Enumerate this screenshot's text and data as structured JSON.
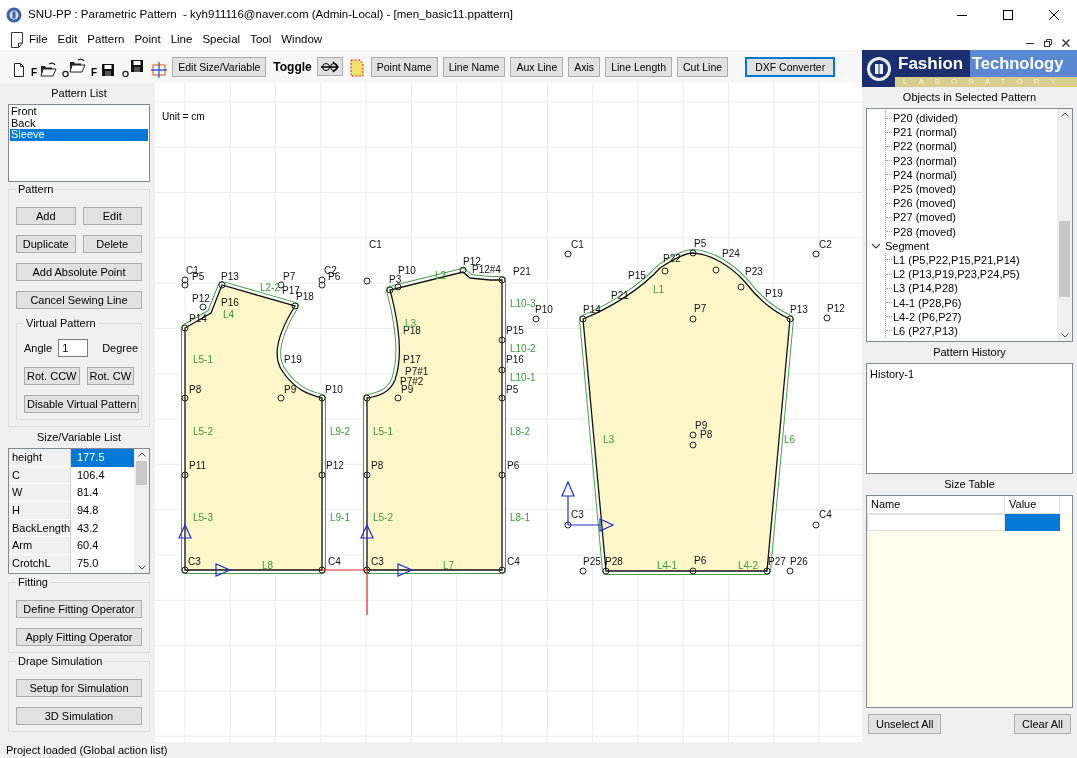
{
  "window": {
    "title": "SNU-PP : Parametric Pattern  - kyh911116@naver.com (Admin-Local) - [men_basic11.ppattern]"
  },
  "menu": [
    "File",
    "Edit",
    "Pattern",
    "Point",
    "Line",
    "Special",
    "Tool",
    "Window"
  ],
  "toolbar": [
    {
      "kind": "new"
    },
    {
      "kind": "open",
      "letter": "F"
    },
    {
      "kind": "open-circle"
    },
    {
      "kind": "save",
      "letter": "F"
    },
    {
      "kind": "save-circle"
    },
    {
      "kind": "grid"
    },
    {
      "kind": "button",
      "label": "Edit Size/Variable",
      "focused": false
    },
    {
      "kind": "text",
      "label": "Toggle"
    },
    {
      "kind": "toggle"
    },
    {
      "kind": "outline"
    },
    {
      "kind": "button",
      "label": "Point Name",
      "focused": false
    },
    {
      "kind": "button",
      "label": "Line Name",
      "focused": false
    },
    {
      "kind": "button",
      "label": "Aux Line",
      "focused": false
    },
    {
      "kind": "button",
      "label": "Axis",
      "focused": false
    },
    {
      "kind": "button",
      "label": "Line Length",
      "focused": false
    },
    {
      "kind": "button",
      "label": "Cut Line",
      "focused": false
    },
    {
      "kind": "button",
      "label": "DXF Converter",
      "focused": true
    }
  ],
  "pattern_list": {
    "title": "Pattern List",
    "items": [
      {
        "label": "Front",
        "selected": false
      },
      {
        "label": "Back",
        "selected": false
      },
      {
        "label": "Sleeve",
        "selected": true
      }
    ]
  },
  "pattern_group": {
    "title": "Pattern",
    "buttons": [
      "Add",
      "Edit",
      "Duplicate",
      "Delete",
      "Add Absolute Point",
      "Cancel Sewing Line"
    ],
    "virtual_pattern": {
      "title": "Virtual Pattern",
      "angle_label": "Angle",
      "angle_value": "1",
      "unit": "Degree",
      "buttons": [
        "Rot. CCW",
        "Rot. CW",
        "Disable Virtual Pattern"
      ]
    }
  },
  "size_list": {
    "title": "Size/Variable List",
    "rows": [
      {
        "name": "height",
        "value": "177.5",
        "selected": true
      },
      {
        "name": "C",
        "value": "106.4",
        "selected": false
      },
      {
        "name": "W",
        "value": "81.4",
        "selected": false
      },
      {
        "name": "H",
        "value": "94.8",
        "selected": false
      },
      {
        "name": "BackLength",
        "value": "43.2",
        "selected": false
      },
      {
        "name": "Arm",
        "value": "60.4",
        "selected": false
      },
      {
        "name": "CrotchL",
        "value": "75.0",
        "selected": false
      }
    ]
  },
  "fitting": {
    "title": "Fitting",
    "buttons": [
      "Define Fitting Operator",
      "Apply Fitting Operator"
    ]
  },
  "drape": {
    "title": "Drape Simulation",
    "buttons": [
      "Setup for Simulation",
      "3D Simulation"
    ]
  },
  "canvas": {
    "unit_label": "Unit = cm",
    "pieces": [
      {
        "kind": "front",
        "point_labels": [
          "C1",
          "P5",
          "P13",
          "P7",
          "C2",
          "P6",
          "P17",
          "P18",
          "P12",
          "P16",
          "P14",
          "P19",
          "P8",
          "P9",
          "P10",
          "P11",
          "P12",
          "C3",
          "C4"
        ],
        "line_labels": [
          "L2-2",
          "L4",
          "L5-1",
          "L5-2",
          "L9-2",
          "L5-3",
          "L9-1",
          "L8"
        ]
      },
      {
        "kind": "back",
        "point_labels": [
          "C1",
          "P10",
          "P3",
          "P12",
          "P12#4",
          "P21",
          "P10",
          "P18",
          "P15",
          "P16",
          "P17",
          "P7#1",
          "P7#2",
          "P5",
          "P9",
          "P8",
          "P6",
          "C3",
          "C4"
        ],
        "line_labels": [
          "L2",
          "L10-3",
          "L3",
          "L10-2",
          "L10-1",
          "L5-1",
          "L8-2",
          "L5-2",
          "L8-1",
          "L7"
        ]
      },
      {
        "kind": "sleeve",
        "point_labels": [
          "C1",
          "P5",
          "C2",
          "P22",
          "P24",
          "P23",
          "P15",
          "P21",
          "P19",
          "P14",
          "P7",
          "P13",
          "P12",
          "P9",
          "P8",
          "C3",
          "C4",
          "P25",
          "P28",
          "P6",
          "P27",
          "P26"
        ],
        "line_labels": [
          "L1",
          "L3",
          "L6",
          "L4-1",
          "L4-2"
        ]
      }
    ]
  },
  "logo": {
    "word_1": "Fashion",
    "word_2": "Technology",
    "subtitle": "LABORATORY"
  },
  "objects": {
    "title": "Objects in Selected Pattern",
    "tree": [
      {
        "children": [
          {
            "label": "P20 (divided)"
          },
          {
            "label": "P21 (normal)"
          },
          {
            "label": "P22 (normal)"
          },
          {
            "label": "P23 (normal)"
          },
          {
            "label": "P24 (normal)"
          },
          {
            "label": "P25 (moved)"
          },
          {
            "label": "P26 (moved)"
          },
          {
            "label": "P27 (moved)"
          },
          {
            "label": "P28 (moved)"
          }
        ]
      },
      {
        "label": "Segment",
        "expanded": true,
        "children": [
          {
            "label": "L1 (P5,P22,P15,P21,P14)"
          },
          {
            "label": "L2 (P13,P19,P23,P24,P5)"
          },
          {
            "label": "L3 (P14,P28)"
          },
          {
            "label": "L4-1 (P28,P6)"
          },
          {
            "label": "L4-2 (P6,P27)"
          },
          {
            "label": "L6 (P27,P13)"
          }
        ]
      }
    ]
  },
  "history": {
    "title": "Pattern History",
    "items": [
      "History-1"
    ]
  },
  "size_table": {
    "title": "Size Table",
    "columns": [
      "Name",
      "Value"
    ],
    "rows": [
      {
        "selected": true
      }
    ]
  },
  "panel_buttons": [
    "Unselect All",
    "Clear All"
  ],
  "status_bar": "Project loaded (Global action list)"
}
